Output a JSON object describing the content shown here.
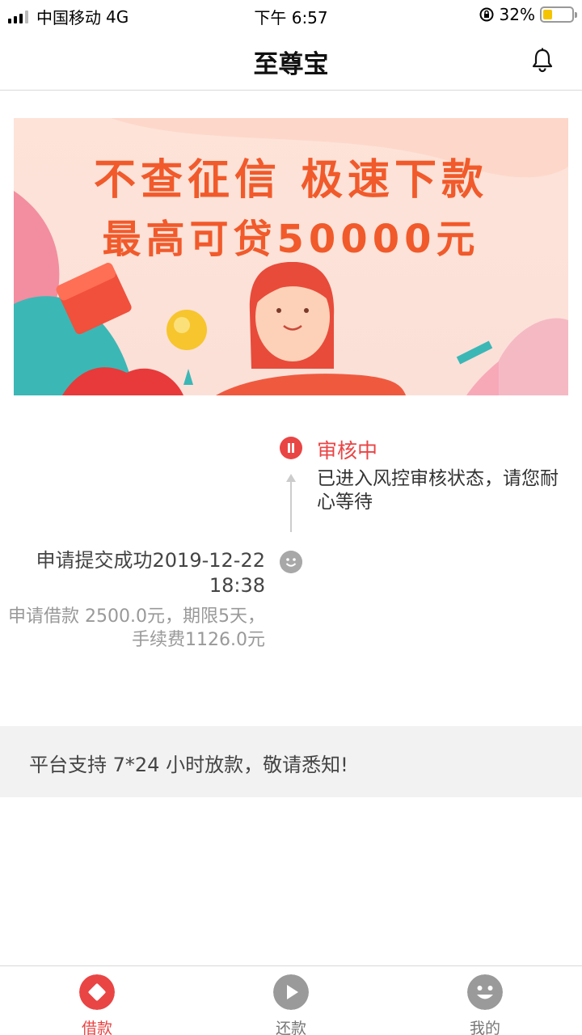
{
  "status_bar": {
    "carrier": "中国移动",
    "network": "4G",
    "time": "下午 6:57",
    "battery": "32%",
    "battery_level": 0.32
  },
  "nav": {
    "title": "至尊宝",
    "bell_icon": "bell-icon"
  },
  "banner": {
    "line1": "不查征信 极速下款",
    "line2": "最高可贷50000元"
  },
  "timeline": {
    "current_status": "审核中",
    "current_status_icon": "pause-icon",
    "current_desc": "已进入风控审核状态，请您耐心等待",
    "submit_title": "申请提交成功",
    "submit_time": "2019-12-22 18:38",
    "submit_icon": "smile-icon",
    "submit_detail": "申请借款 2500.0元，期限5天，手续费1126.0元"
  },
  "notice": {
    "text": "平台支持 7*24 小时放款，敬请悉知!"
  },
  "tabs": [
    {
      "label": "借款",
      "icon": "loan-icon",
      "active": true
    },
    {
      "label": "还款",
      "icon": "play-icon",
      "active": false
    },
    {
      "label": "我的",
      "icon": "profile-smile-icon",
      "active": false
    }
  ],
  "colors": {
    "accent": "#e94545",
    "banner_text": "#f15a2b"
  }
}
